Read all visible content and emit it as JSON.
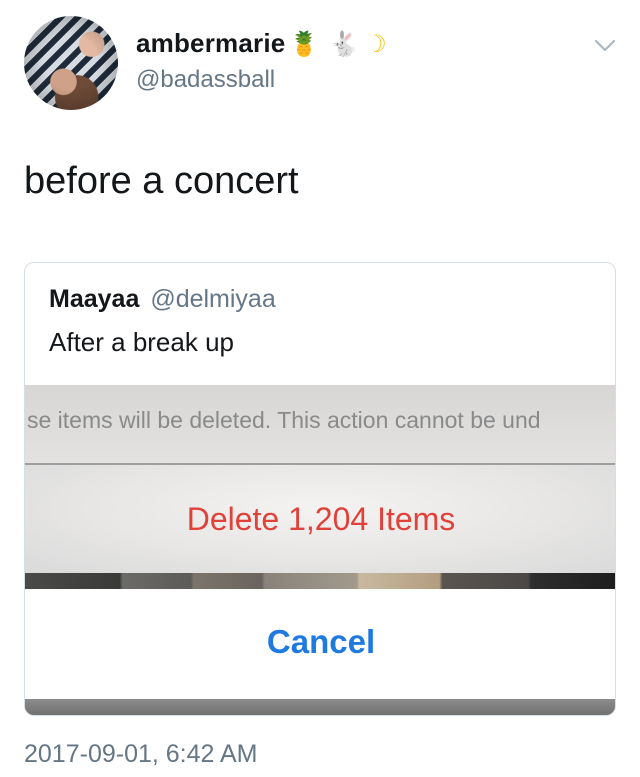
{
  "tweet": {
    "author": {
      "display_name": "ambermarie",
      "handle": "@badassball",
      "emojis": [
        {
          "name": "pineapple-emoji",
          "glyph": "🍍"
        },
        {
          "name": "rabbit-emoji",
          "glyph": "🐇"
        },
        {
          "name": "crescent-moon-emoji",
          "glyph": "☽"
        }
      ]
    },
    "menu_icon": "chevron-down-icon",
    "text": "before a concert",
    "timestamp": "2017-09-01, 6:42 AM"
  },
  "quoted_tweet": {
    "author_name": "Maayaa",
    "handle": "@delmiyaa",
    "text": "After a break up",
    "image": {
      "message": "se items will be deleted. This action cannot be und",
      "delete_label": "Delete 1,204 Items",
      "cancel_label": "Cancel",
      "delete_color": "#e0423a",
      "cancel_color": "#1f7ae0"
    }
  },
  "colors": {
    "text_primary": "#14171a",
    "text_secondary": "#657786",
    "border": "#d6dde3"
  }
}
